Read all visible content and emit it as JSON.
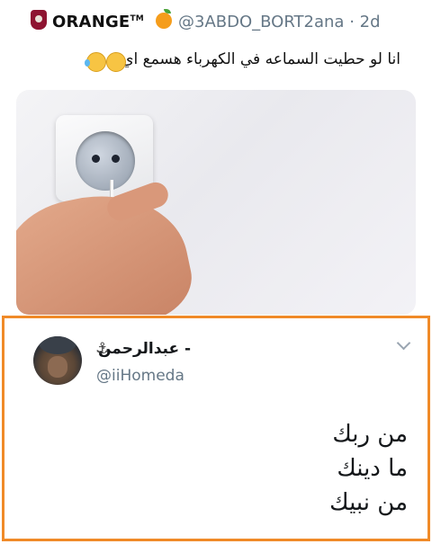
{
  "top_tweet": {
    "brand_name": "ORANGE",
    "brand_mark": "TM",
    "handle": "@3ABDO_BORT2ana",
    "time": "· 2d",
    "text": "انا لو حطيت السماعه في الكهرباء هسمع اي",
    "emojis": [
      "laughing-tears-emoji",
      "thinking-emoji"
    ]
  },
  "reply_tweet": {
    "name": "- عبدالرحمن",
    "name_icon": "anchor-icon",
    "handle": "@iiHomeda",
    "lines": [
      "من ربك",
      "ما دينك",
      "من نبيك"
    ]
  },
  "colors": {
    "frame": "#f08a28",
    "handle_gray": "#657786",
    "brand_orange": "#f59d1c"
  }
}
